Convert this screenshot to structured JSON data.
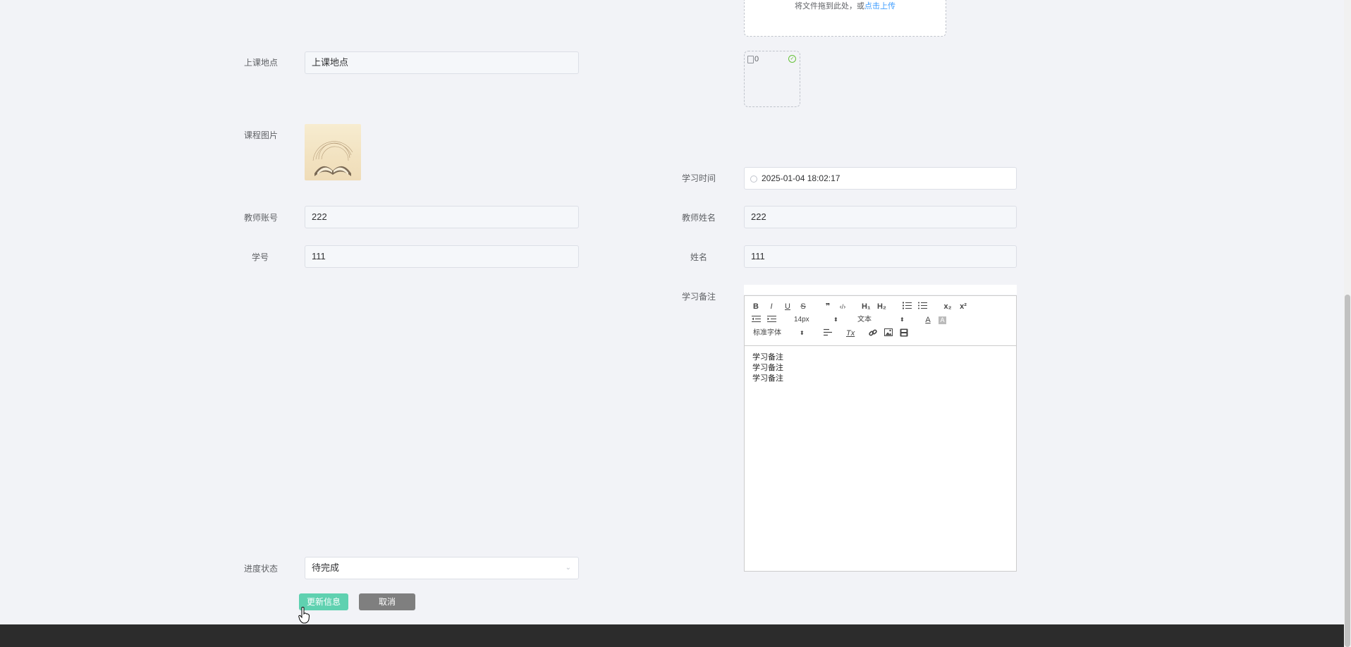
{
  "upload": {
    "drop_text": "将文件拖到此处，或",
    "drop_link": "点击上传",
    "file_name": "0"
  },
  "form": {
    "location": {
      "label": "上课地点",
      "value": "上课地点"
    },
    "course_image": {
      "label": "课程图片"
    },
    "study_time": {
      "label": "学习时间",
      "value": "2025-01-04 18:02:17"
    },
    "teacher_account": {
      "label": "教师账号",
      "value": "222"
    },
    "teacher_name": {
      "label": "教师姓名",
      "value": "222"
    },
    "student_id": {
      "label": "学号",
      "value": "111"
    },
    "student_name": {
      "label": "姓名",
      "value": "111"
    },
    "study_note": {
      "label": "学习备注",
      "content_lines": [
        "学习备注",
        "学习备注",
        "学习备注"
      ]
    },
    "progress_status": {
      "label": "进度状态",
      "value": "待完成"
    }
  },
  "editor": {
    "font_size": "14px",
    "header_select": "文本",
    "font_family": "标准字体",
    "icons": {
      "bold": "B",
      "italic": "I",
      "underline": "U",
      "strike": "S",
      "quote": "❞",
      "code": "‹/›",
      "h1": "H₁",
      "h2": "H₂",
      "subscript": "x₂",
      "superscript": "x²",
      "text_color": "A",
      "background": "A",
      "clean": "Tx"
    }
  },
  "buttons": {
    "update": "更新信息",
    "cancel": "取消"
  }
}
